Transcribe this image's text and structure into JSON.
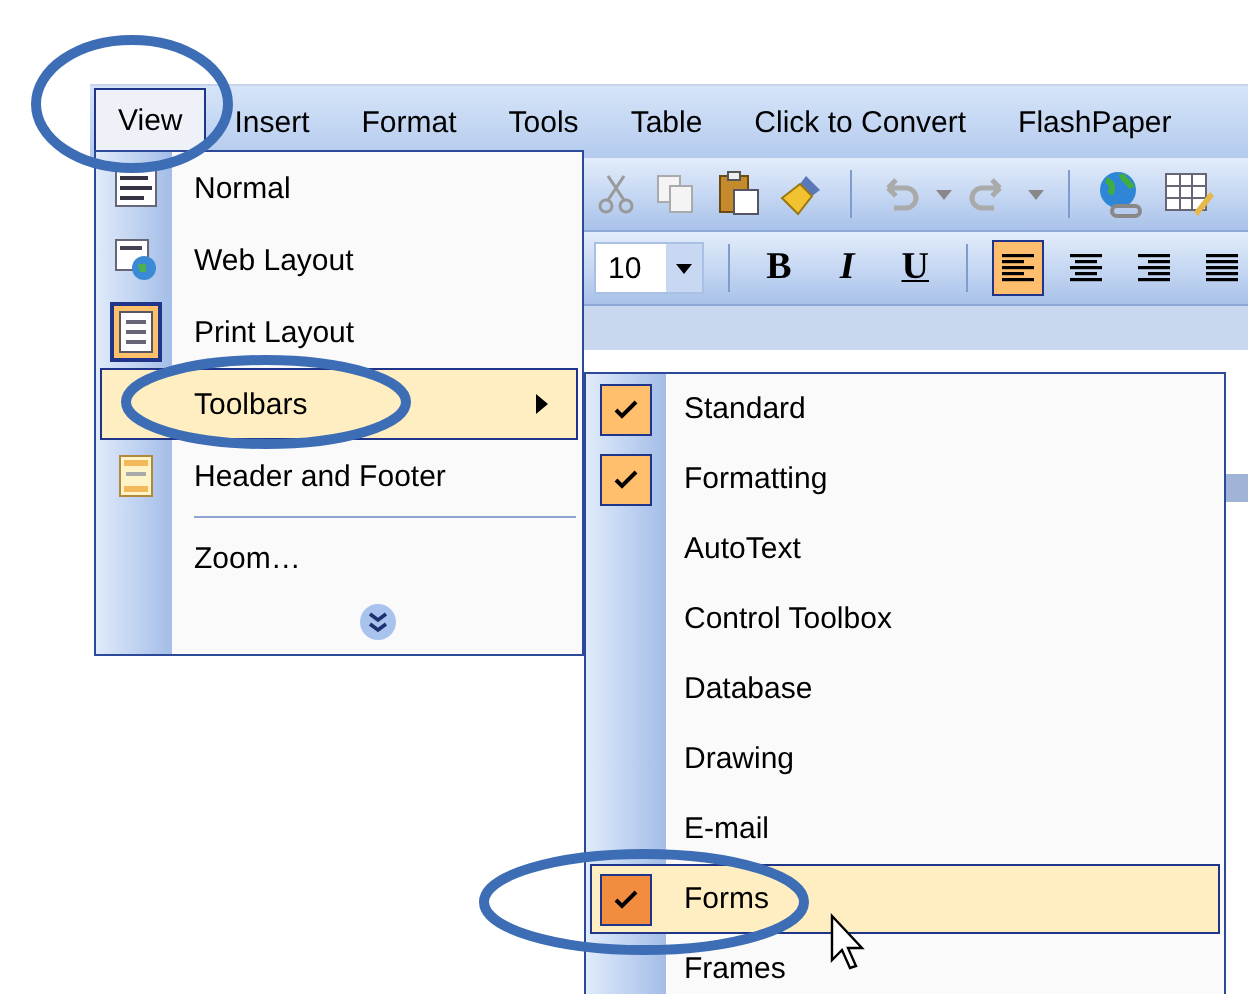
{
  "menu_bar": [
    {
      "label": "View",
      "selected": true
    },
    {
      "label": "Insert",
      "selected": false
    },
    {
      "label": "Format",
      "selected": false
    },
    {
      "label": "Tools",
      "selected": false
    },
    {
      "label": "Table",
      "selected": false
    },
    {
      "label": "Click to Convert",
      "selected": false
    },
    {
      "label": "FlashPaper",
      "selected": false
    }
  ],
  "formatting_toolbar": {
    "font_size": "10",
    "styles": [
      {
        "label": "B",
        "kind": "bold"
      },
      {
        "label": "I",
        "kind": "italic"
      },
      {
        "label": "U",
        "kind": "underline"
      }
    ],
    "alignment": [
      {
        "kind": "left",
        "selected": true
      },
      {
        "kind": "center",
        "selected": false
      },
      {
        "kind": "right",
        "selected": false
      },
      {
        "kind": "justify",
        "selected": false
      }
    ]
  },
  "view_menu": {
    "items": [
      {
        "label": "Normal",
        "kind": "normal",
        "checked": false,
        "selected": false,
        "separator_before": false
      },
      {
        "label": "Web Layout",
        "kind": "web",
        "checked": false,
        "selected": false,
        "separator_before": false
      },
      {
        "label": "Print Layout",
        "kind": "print",
        "checked": true,
        "selected": false,
        "separator_before": false
      },
      {
        "label": "Toolbars",
        "kind": "submenu",
        "checked": false,
        "selected": true,
        "separator_before": false
      },
      {
        "label": "Header and Footer",
        "kind": "header",
        "checked": false,
        "selected": false,
        "separator_before": false
      },
      {
        "label": "Zoom…",
        "kind": "plain",
        "checked": false,
        "selected": false,
        "separator_before": true
      }
    ]
  },
  "toolbars_submenu": {
    "items": [
      {
        "label": "Standard",
        "checked": true,
        "selected": false
      },
      {
        "label": "Formatting",
        "checked": true,
        "selected": false
      },
      {
        "label": "AutoText",
        "checked": false,
        "selected": false
      },
      {
        "label": "Control Toolbox",
        "checked": false,
        "selected": false
      },
      {
        "label": "Database",
        "checked": false,
        "selected": false
      },
      {
        "label": "Drawing",
        "checked": false,
        "selected": false
      },
      {
        "label": "E-mail",
        "checked": false,
        "selected": false
      },
      {
        "label": "Forms",
        "checked": true,
        "selected": true
      },
      {
        "label": "Frames",
        "checked": false,
        "selected": false
      }
    ]
  }
}
